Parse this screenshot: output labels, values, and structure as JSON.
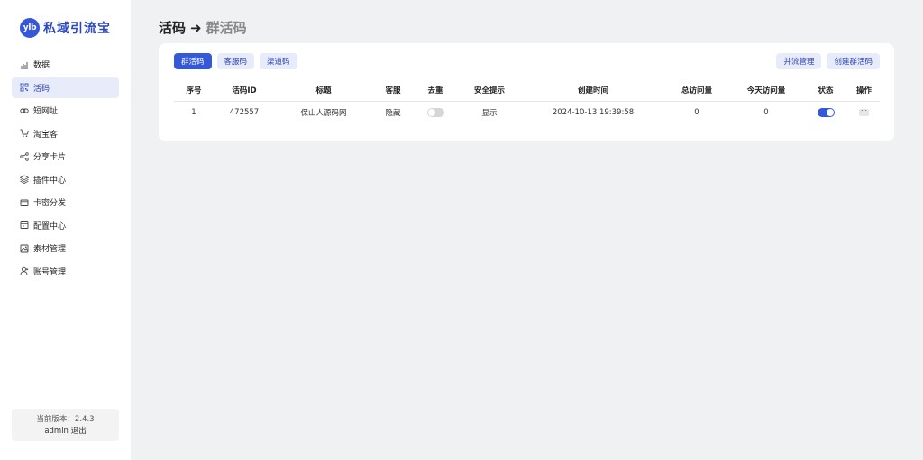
{
  "app": {
    "logo_badge": "ylb",
    "logo_text": "私域引流宝"
  },
  "sidebar": {
    "items": [
      {
        "label": "数据",
        "icon": "chart-icon"
      },
      {
        "label": "活码",
        "icon": "qrcode-icon",
        "active": true
      },
      {
        "label": "短网址",
        "icon": "link-icon"
      },
      {
        "label": "淘宝客",
        "icon": "cart-icon"
      },
      {
        "label": "分享卡片",
        "icon": "share-icon"
      },
      {
        "label": "插件中心",
        "icon": "layers-icon"
      },
      {
        "label": "卡密分发",
        "icon": "card-icon"
      },
      {
        "label": "配置中心",
        "icon": "settings-card-icon"
      },
      {
        "label": "素材管理",
        "icon": "image-icon"
      },
      {
        "label": "账号管理",
        "icon": "user-icon"
      }
    ],
    "version_label": "当前版本：2.4.3",
    "username": "admin",
    "logout_label": "退出"
  },
  "header": {
    "title": "活码",
    "arrow": "➜",
    "subtitle": "群活码"
  },
  "tabs": [
    {
      "label": "群活码",
      "active": true
    },
    {
      "label": "客服码"
    },
    {
      "label": "渠道码"
    }
  ],
  "actions": {
    "merge_label": "并流管理",
    "create_label": "创建群活码"
  },
  "table": {
    "headers": [
      "序号",
      "活码ID",
      "标题",
      "客服",
      "去重",
      "安全提示",
      "创建时间",
      "总访问量",
      "今天访问量",
      "状态",
      "操作"
    ],
    "rows": [
      {
        "index": "1",
        "id": "472557",
        "title": "保山人源码网",
        "service": "隐藏",
        "dedupe_on": false,
        "safety": "显示",
        "created": "2024-10-13 19:39:58",
        "total_visits": "0",
        "today_visits": "0",
        "status_on": true,
        "more": "···"
      }
    ]
  },
  "colors": {
    "accent": "#3558d8",
    "accent_light": "#e8ebfa",
    "background": "#f0f1f2"
  }
}
